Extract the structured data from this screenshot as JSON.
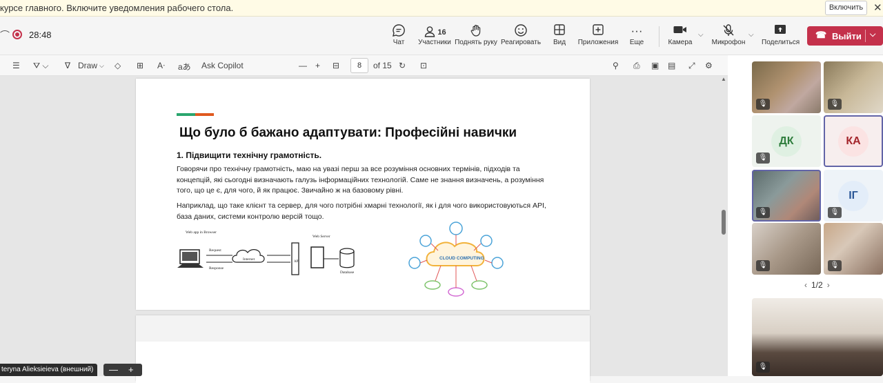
{
  "notification": {
    "text": "курсе главного. Включите уведомления рабочего стола.",
    "enable_label": "Включить",
    "close_glyph": "✕"
  },
  "meeting": {
    "timer": "28:48",
    "participants_count": "16",
    "toolbar": {
      "chat": "Чат",
      "participants": "Участники",
      "raise_hand": "Поднять руку",
      "react": "Реагировать",
      "view": "Вид",
      "apps": "Приложения",
      "more": "Еще",
      "camera": "Камера",
      "mic": "Микрофон",
      "share": "Поделиться",
      "leave": "Выйти"
    }
  },
  "pdf_toolbar": {
    "draw_label": "Draw",
    "ask_copilot": "Ask Copilot",
    "current_page": "8",
    "page_total": "of 15"
  },
  "slide": {
    "title": "Що було б бажано адаптувати: Професійні навички",
    "heading": "1. Підвищити технічну грамотність.",
    "paragraph1": "Говорячи про технічну грамотність, маю на увазі перш за все розуміння основних термінів, підходів та концепцій, які сьогодні визначають галузь інформаційних технологій. Саме не знання визначень, а розуміння того, що це є, для чого, й як працює. Звичайно ж на базовому рівні.",
    "paragraph2": "Наприклад, що таке клієнт та сервер, для чого потрібні хмарні технології, як  і для чого використовуються API, база даних, системи контролю версій тощо.",
    "diagram_labels": {
      "web_app": "Web app in Browser",
      "request": "Request",
      "response": "Response",
      "internet": "Internet",
      "api": "API",
      "web_server": "Web Server",
      "database": "Database",
      "cloud": "CLOUD COMPUTING"
    }
  },
  "presenter_name": "teryna Alieksieieva (внешний)",
  "zoom": {
    "minus": "—",
    "plus": "+"
  },
  "participants": {
    "tiles": [
      {
        "kind": "video"
      },
      {
        "kind": "video"
      },
      {
        "kind": "avatar",
        "initials": "ДК",
        "bg": "#dff0e2",
        "fg": "#2e7d3c"
      },
      {
        "kind": "avatar",
        "initials": "КА",
        "bg": "#fbe3e3",
        "fg": "#a4262c",
        "selected": true
      },
      {
        "kind": "video",
        "selected": true
      },
      {
        "kind": "avatar",
        "initials": "ІГ",
        "bg": "#e3edf9",
        "fg": "#2b5797"
      },
      {
        "kind": "video"
      },
      {
        "kind": "video"
      }
    ],
    "pager": "1/2"
  },
  "colors": {
    "leave": "#c4314b",
    "accent_purple": "#6264a7"
  }
}
